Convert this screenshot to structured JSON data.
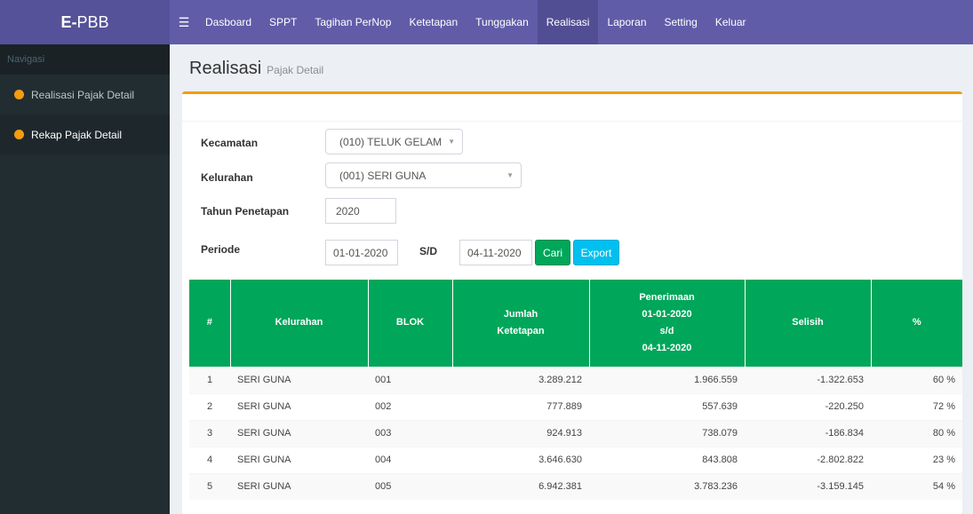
{
  "brand": {
    "prefix": "E-",
    "name": "PBB"
  },
  "menu": [
    "Dasboard",
    "SPPT",
    "Tagihan PerNop",
    "Ketetapan",
    "Tunggakan",
    "Realisasi",
    "Laporan",
    "Setting",
    "Keluar"
  ],
  "sidebar": {
    "header": "Navigasi",
    "items": [
      {
        "label": "Realisasi Pajak Detail"
      },
      {
        "label": "Rekap Pajak Detail"
      }
    ]
  },
  "page": {
    "title": "Realisasi",
    "subtitle": "Pajak Detail"
  },
  "form": {
    "kecamatan_label": "Kecamatan",
    "kecamatan_value": "(010) TELUK GELAM",
    "kelurahan_label": "Kelurahan",
    "kelurahan_value": "(001) SERI GUNA",
    "tahun_label": "Tahun Penetapan",
    "tahun_value": "2020",
    "periode_label": "Periode",
    "periode_start": "01-01-2020",
    "sd_label": "S/D",
    "periode_end": "04-11-2020",
    "cari_label": "Cari",
    "export_label": "Export"
  },
  "table": {
    "headers": {
      "no": "#",
      "kelurahan": "Kelurahan",
      "blok": "BLOK",
      "ketetapan_1": "Jumlah",
      "ketetapan_2": "Ketetapan",
      "penerimaan_1": "Penerimaan",
      "penerimaan_2": "01-01-2020",
      "penerimaan_3": "s/d",
      "penerimaan_4": "04-11-2020",
      "selisih": "Selisih",
      "persen": "%"
    },
    "rows": [
      {
        "no": "1",
        "kelurahan": "SERI GUNA",
        "blok": "001",
        "ketetapan": "3.289.212",
        "penerimaan": "1.966.559",
        "selisih": "-1.322.653",
        "persen": "60 %"
      },
      {
        "no": "2",
        "kelurahan": "SERI GUNA",
        "blok": "002",
        "ketetapan": "777.889",
        "penerimaan": "557.639",
        "selisih": "-220.250",
        "persen": "72 %"
      },
      {
        "no": "3",
        "kelurahan": "SERI GUNA",
        "blok": "003",
        "ketetapan": "924.913",
        "penerimaan": "738.079",
        "selisih": "-186.834",
        "persen": "80 %"
      },
      {
        "no": "4",
        "kelurahan": "SERI GUNA",
        "blok": "004",
        "ketetapan": "3.646.630",
        "penerimaan": "843.808",
        "selisih": "-2.802.822",
        "persen": "23 %"
      },
      {
        "no": "5",
        "kelurahan": "SERI GUNA",
        "blok": "005",
        "ketetapan": "6.942.381",
        "penerimaan": "3.783.236",
        "selisih": "-3.159.145",
        "persen": "54 %"
      }
    ]
  },
  "colors": {
    "navbar": "#605ca8",
    "sidebar": "#222d32",
    "accent": "#f39c12",
    "table_header": "#00a65a",
    "export_button": "#00c0ef"
  },
  "icons": {
    "menu_toggle": "hamburger-icon",
    "sidebar_bullet": "circle-icon",
    "select_caret": "caret-down-icon"
  }
}
